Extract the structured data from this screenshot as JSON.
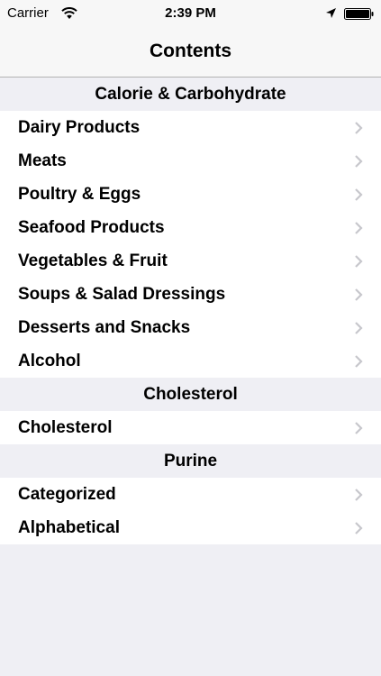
{
  "status_bar": {
    "carrier": "Carrier",
    "time": "2:39 PM",
    "icons": [
      "wifi-icon",
      "location-icon",
      "battery-icon"
    ]
  },
  "nav": {
    "title": "Contents"
  },
  "sections": [
    {
      "header": "Calorie & Carbohydrate",
      "items": [
        {
          "label": "Dairy Products"
        },
        {
          "label": "Meats"
        },
        {
          "label": "Poultry & Eggs"
        },
        {
          "label": "Seafood Products"
        },
        {
          "label": "Vegetables & Fruit"
        },
        {
          "label": "Soups & Salad Dressings"
        },
        {
          "label": "Desserts and Snacks"
        },
        {
          "label": "Alcohol"
        }
      ]
    },
    {
      "header": "Cholesterol",
      "items": [
        {
          "label": "Cholesterol"
        }
      ]
    },
    {
      "header": "Purine",
      "items": [
        {
          "label": "Categorized"
        },
        {
          "label": "Alphabetical"
        }
      ]
    }
  ],
  "colors": {
    "background": "#efeff4",
    "bar": "#f7f7f7",
    "chevron": "#c7c7cc"
  }
}
